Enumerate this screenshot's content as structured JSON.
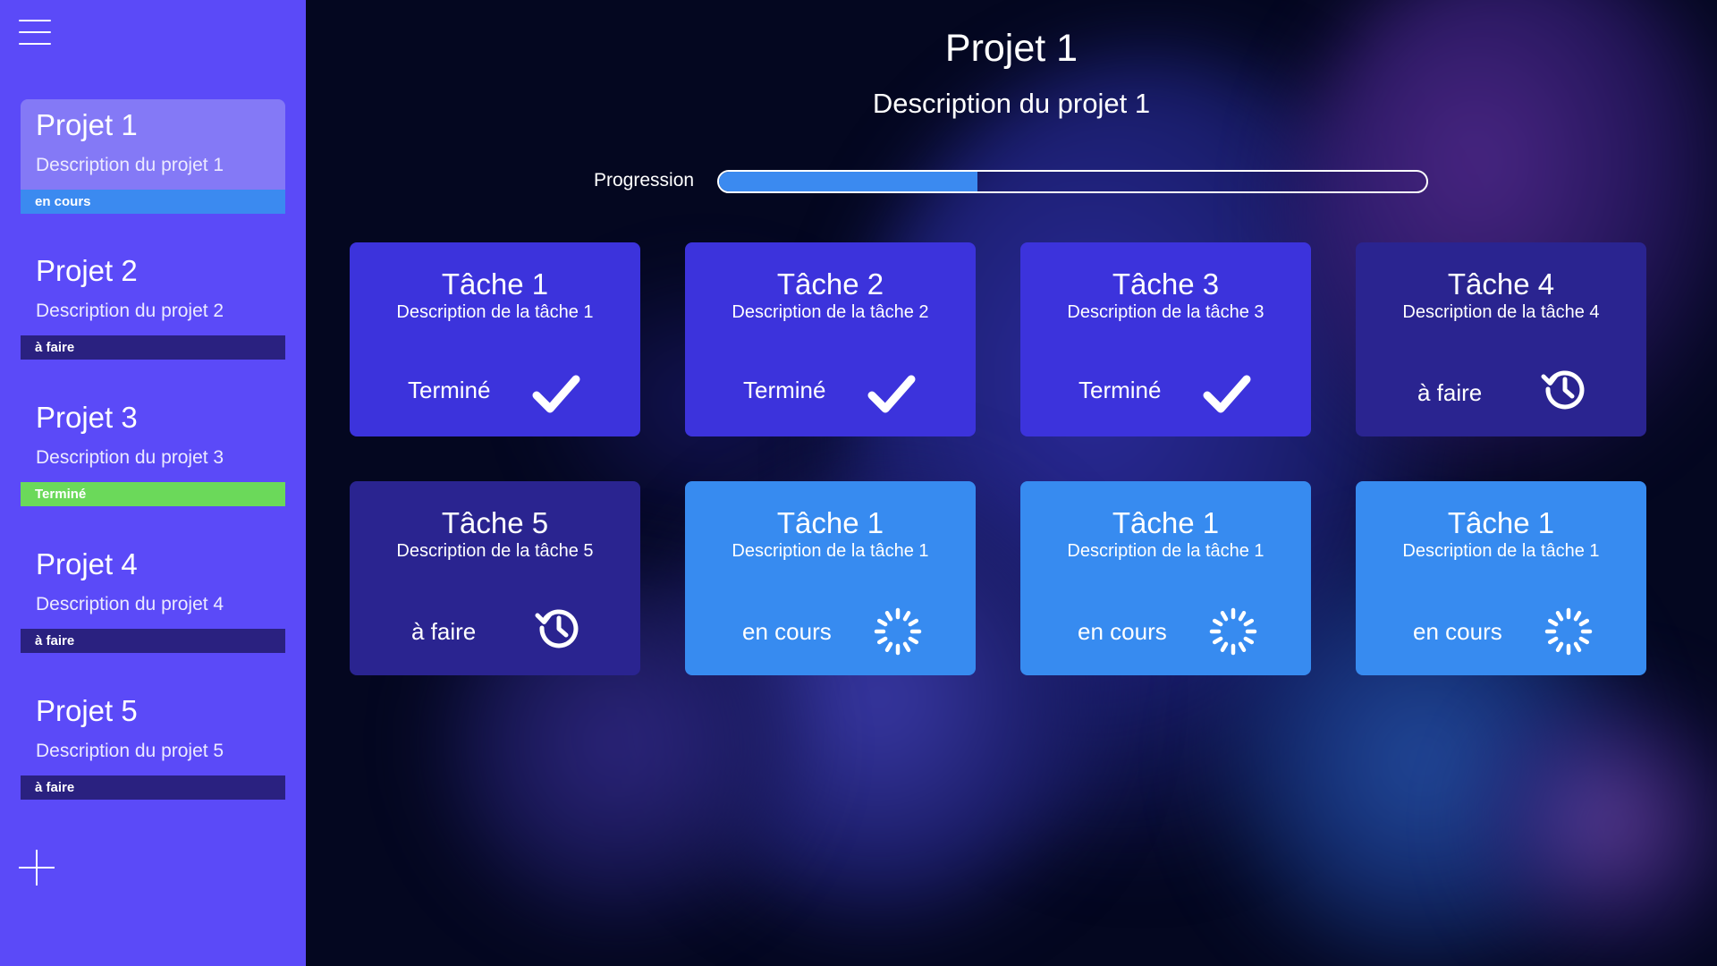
{
  "sidebar": {
    "projects": [
      {
        "title": "Projet 1",
        "description": "Description du projet 1",
        "status": "en cours"
      },
      {
        "title": "Projet 2",
        "description": "Description du projet 2",
        "status": "à faire"
      },
      {
        "title": "Projet 3",
        "description": "Description du projet 3",
        "status": "Terminé"
      },
      {
        "title": "Projet 4",
        "description": "Description du projet 4",
        "status": "à faire"
      },
      {
        "title": "Projet 5",
        "description": "Description du projet 5",
        "status": "à faire"
      }
    ],
    "menu_icon": "hamburger-icon",
    "add_icon": "plus-icon"
  },
  "header": {
    "title": "Projet 1",
    "description": "Description du projet 1",
    "progress_label": "Progression",
    "progress_value": 0.365
  },
  "tasks": [
    {
      "title": "Tâche 1",
      "description": "Description de la tâche 1",
      "status": "Terminé",
      "icon": "checkmark-icon"
    },
    {
      "title": "Tâche 2",
      "description": "Description de la tâche 2",
      "status": "Terminé",
      "icon": "checkmark-icon"
    },
    {
      "title": "Tâche 3",
      "description": "Description de la tâche 3",
      "status": "Terminé",
      "icon": "checkmark-icon"
    },
    {
      "title": "Tâche 4",
      "description": "Description de la tâche 4",
      "status": "à faire",
      "icon": "history-clock-icon"
    },
    {
      "title": "Tâche 5",
      "description": "Description de la tâche 5",
      "status": "à faire",
      "icon": "history-clock-icon"
    },
    {
      "title": "Tâche 1",
      "description": "Description de la tâche 1",
      "status": "en cours",
      "icon": "loading-spinner-icon"
    },
    {
      "title": "Tâche 1",
      "description": "Description de la tâche 1",
      "status": "en cours",
      "icon": "loading-spinner-icon"
    },
    {
      "title": "Tâche 1",
      "description": "Description de la tâche 1",
      "status": "en cours",
      "icon": "loading-spinner-icon"
    }
  ],
  "colors": {
    "sidebar": "#5b4af8",
    "active_project": "#8479f6",
    "status_en_cours": "#3b8af0",
    "status_a_faire": "#2a2180",
    "status_termine": "#6bd95a",
    "card_done": "#3c33dc",
    "card_todo": "#2a2490",
    "card_in_progress": "#378bf0"
  }
}
